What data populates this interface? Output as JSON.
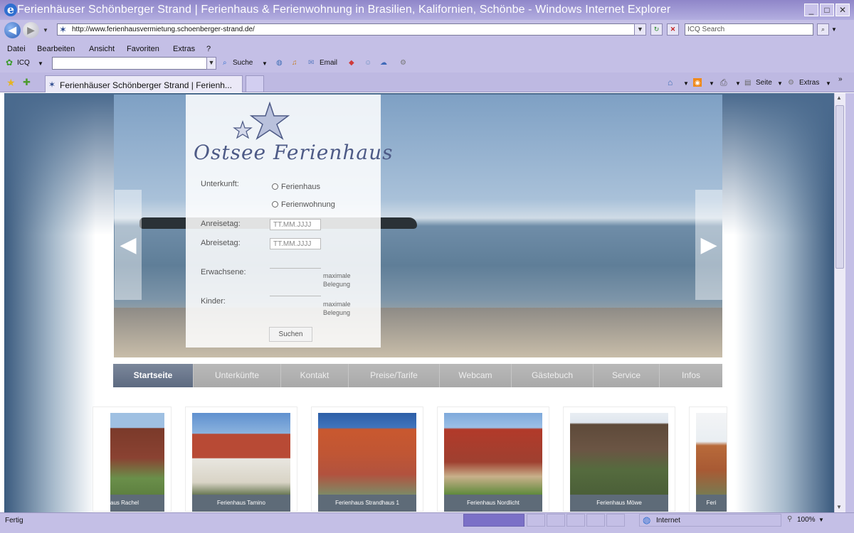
{
  "window": {
    "title": "Ferienhäuser Schönberger Strand | Ferienhaus & Ferienwohnung in Brasilien, Kalifornien, Schönbe - Windows Internet Explorer",
    "min": "_",
    "max": "□",
    "close": "✕"
  },
  "address": {
    "url": "http://www.ferienhausvermietung.schoenberger-strand.de/",
    "search_placeholder": "ICQ Search"
  },
  "menu": [
    "Datei",
    "Bearbeiten",
    "Ansicht",
    "Favoriten",
    "Extras",
    "?"
  ],
  "toolbar": {
    "icq": "ICQ",
    "suche": "Suche",
    "email": "Email"
  },
  "tab": {
    "label": "Ferienhäuser Schönberger Strand | Ferienh..."
  },
  "commandbar": {
    "seite": "Seite",
    "extras": "Extras"
  },
  "site": {
    "logo_text": "Ostsee Ferienhaus",
    "form": {
      "unterkunft_label": "Unterkunft:",
      "opt_ferienhaus": "Ferienhaus",
      "opt_ferienwohnung": "Ferienwohnung",
      "anreise_label": "Anreisetag:",
      "anreise_value": "TT.MM.JJJJ",
      "abreise_label": "Abreisetag:",
      "abreise_value": "TT.MM.JJJJ",
      "erwachsene_label": "Erwachsene:",
      "kinder_label": "Kinder:",
      "note_line1": "maximale",
      "note_line2": "Belegung",
      "submit": "Suchen"
    },
    "nav": [
      "Startseite",
      "Unterkünfte",
      "Kontakt",
      "Preise/Tarife",
      "Webcam",
      "Gästebuch",
      "Service",
      "Infos"
    ],
    "houses": [
      "aus Rachel",
      "Ferienhaus Tamino",
      "Ferienhaus Strandhaus 1",
      "Ferienhaus Nordlicht",
      "Ferienhaus Möwe",
      "Feri"
    ]
  },
  "status": {
    "left": "Fertig",
    "zone": "Internet",
    "zoom": "100%"
  }
}
